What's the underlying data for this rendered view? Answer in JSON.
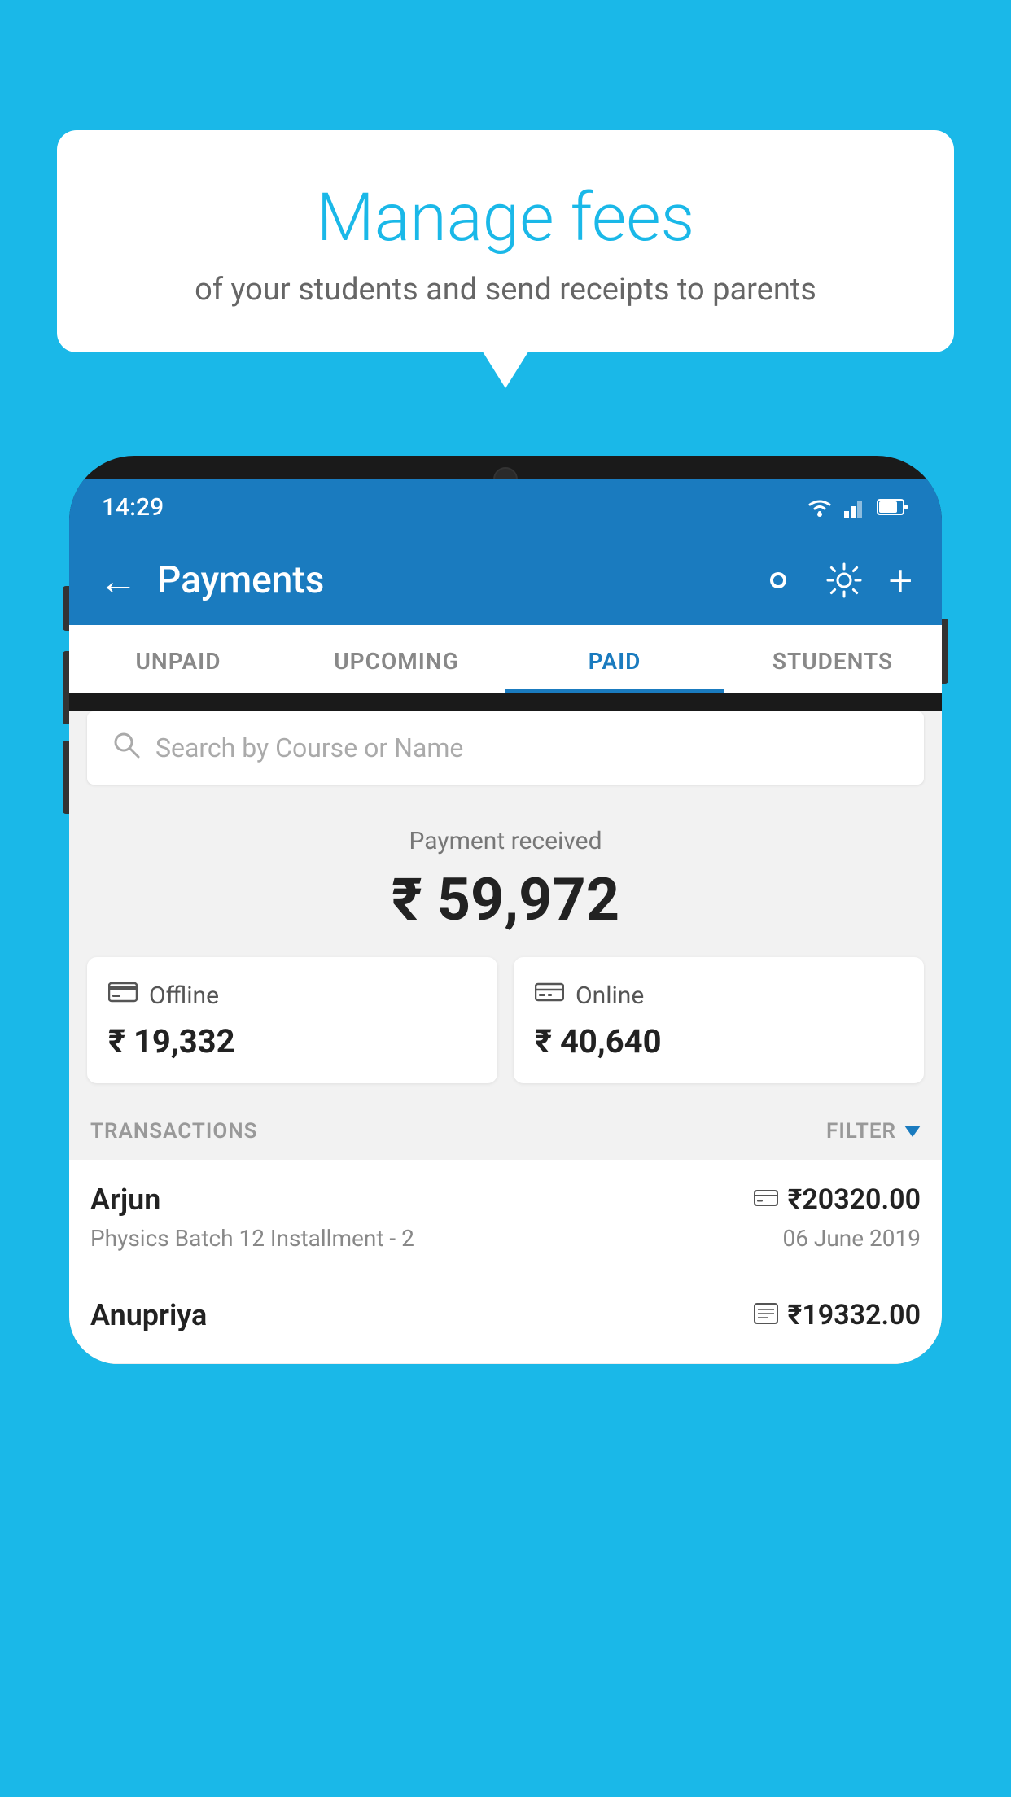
{
  "background_color": "#1ab8e8",
  "bubble": {
    "title": "Manage fees",
    "subtitle": "of your students and send receipts to parents"
  },
  "status_bar": {
    "time": "14:29"
  },
  "app_bar": {
    "title": "Payments",
    "back_icon": "←",
    "plus_icon": "+"
  },
  "tabs": [
    {
      "label": "UNPAID",
      "active": false
    },
    {
      "label": "UPCOMING",
      "active": false
    },
    {
      "label": "PAID",
      "active": true
    },
    {
      "label": "STUDENTS",
      "active": false
    }
  ],
  "search": {
    "placeholder": "Search by Course or Name"
  },
  "payment_received": {
    "label": "Payment received",
    "amount": "₹ 59,972"
  },
  "cards": [
    {
      "type": "Offline",
      "amount": "₹ 19,332",
      "icon": "📋"
    },
    {
      "type": "Online",
      "amount": "₹ 40,640",
      "icon": "💳"
    }
  ],
  "transactions_label": "TRANSACTIONS",
  "filter_label": "FILTER",
  "transactions": [
    {
      "name": "Arjun",
      "course": "Physics Batch 12 Installment - 2",
      "amount": "₹20320.00",
      "date": "06 June 2019",
      "pay_mode": "card"
    },
    {
      "name": "Anupriya",
      "course": "",
      "amount": "₹19332.00",
      "date": "",
      "pay_mode": "offline"
    }
  ]
}
